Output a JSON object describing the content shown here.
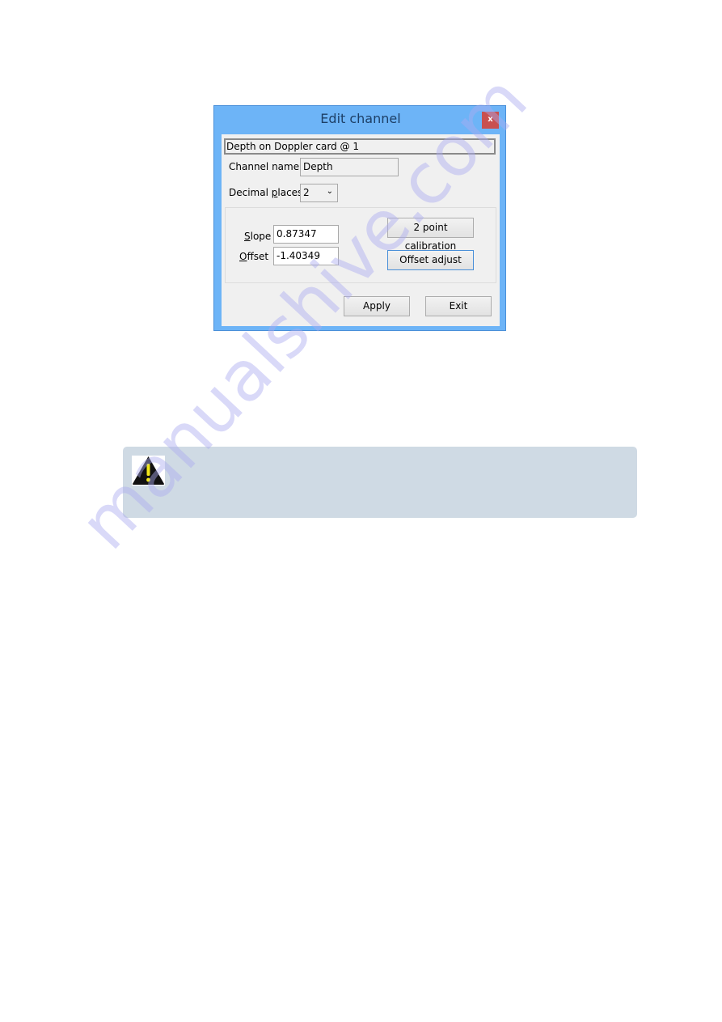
{
  "dialog": {
    "title": "Edit channel",
    "close_label": "x",
    "header_field": "Depth on Doppler card @ 1",
    "channel_name": {
      "label": "Channel name",
      "value": "Depth"
    },
    "decimal_places": {
      "label_pre": "Decimal ",
      "label_u": "p",
      "label_post": "laces",
      "value": "2"
    },
    "slope": {
      "label_u": "S",
      "label_rest": "lope",
      "value": "0.87347"
    },
    "offset": {
      "label_u": "O",
      "label_rest": "ffset",
      "value": "-1.40349"
    },
    "two_point_label": "2 point calibration",
    "offset_adjust_label": "Offset adjust",
    "apply_label": "Apply",
    "exit_label": "Exit",
    "colors": {
      "titlebar": "#6db4f7",
      "close": "#c9504f"
    }
  },
  "warning": {
    "icon": "warning-triangle-icon",
    "background": "#cfdae4"
  },
  "watermark": "manualshive.com"
}
